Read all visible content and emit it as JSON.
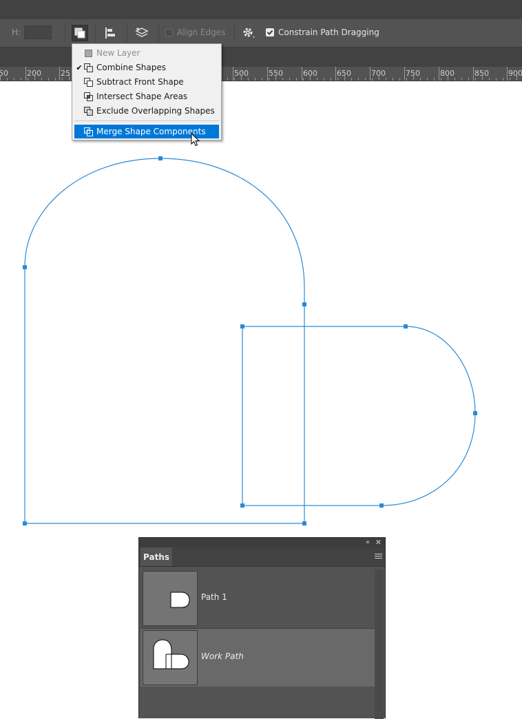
{
  "options_bar": {
    "height_label": "H:",
    "align_edges_label": "Align Edges",
    "constrain_label": "Constrain Path Dragging"
  },
  "ruler": {
    "labels": [
      "50",
      "200",
      "25",
      "500",
      "550",
      "600",
      "650",
      "700",
      "750",
      "800",
      "850",
      "900"
    ]
  },
  "path_ops_menu": {
    "items": [
      {
        "label": "New Layer",
        "state": "disabled"
      },
      {
        "label": "Combine Shapes",
        "state": "checked"
      },
      {
        "label": "Subtract Front Shape",
        "state": "normal"
      },
      {
        "label": "Intersect Shape Areas",
        "state": "normal"
      },
      {
        "label": "Exclude Overlapping Shapes",
        "state": "normal"
      },
      {
        "label": "Merge Shape Components",
        "state": "highlighted"
      }
    ]
  },
  "paths_panel": {
    "tab_label": "Paths",
    "paths": [
      {
        "name": "Path 1",
        "selected": false
      },
      {
        "name": "Work Path",
        "selected": true
      }
    ]
  },
  "colors": {
    "path_stroke": "#2b8ad6",
    "menu_highlight": "#0078d7"
  }
}
